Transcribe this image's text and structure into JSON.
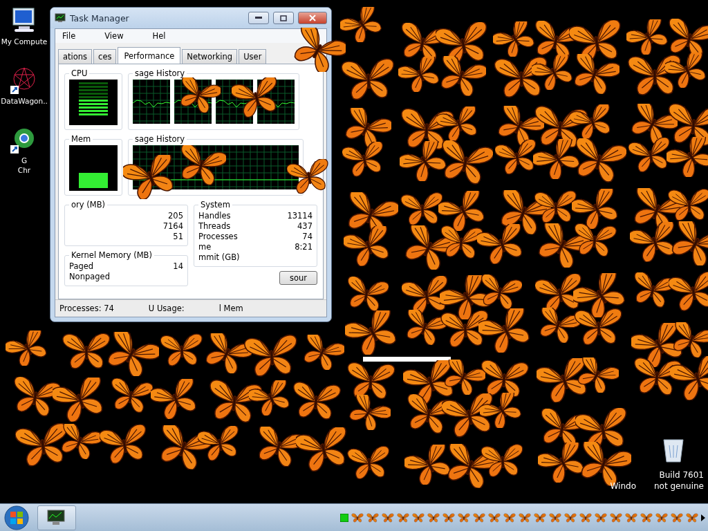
{
  "desktop_icons": [
    {
      "kind": "computer",
      "lines": [
        "My Compute"
      ]
    },
    {
      "kind": "shortcut",
      "lines": [
        "DataWagon.."
      ]
    },
    {
      "kind": "browser",
      "lines": [
        "G",
        "Chr"
      ]
    }
  ],
  "window": {
    "title": "Task Manager",
    "menu": [
      "File",
      "View",
      "Hel"
    ],
    "tabs": [
      {
        "label": "ations",
        "selected": false
      },
      {
        "label": "ces",
        "selected": false
      },
      {
        "label": "Performance",
        "selected": true
      },
      {
        "label": "Networking",
        "selected": false
      },
      {
        "label": "User",
        "selected": false
      }
    ],
    "cpu_title": "CPU",
    "cpu_history_title": "sage History",
    "memory_title": "Mem",
    "memory_history_title": "sage History",
    "physical_memory": {
      "title": "ory (MB)",
      "values": [
        "205",
        "7164",
        "51"
      ]
    },
    "kernel_memory": {
      "title": "Kernel Memory (MB)",
      "rows": [
        {
          "label": "Paged",
          "value": "14"
        },
        {
          "label": "Nonpaged"
        }
      ]
    },
    "system": {
      "title": "System",
      "rows": [
        {
          "label": "Handles",
          "value": "13114"
        },
        {
          "label": "Threads",
          "value": "437"
        },
        {
          "label": "Processes",
          "value": "74"
        },
        {
          "label": "me",
          "value": "8:21"
        },
        {
          "label": "mmit (GB)"
        }
      ]
    },
    "resource_button": "sour",
    "status_bar": [
      "Processes: 74",
      "U Usage:",
      "l Mem"
    ]
  },
  "genuine_notice": {
    "build": "Build 7601",
    "parts": [
      "Windo",
      "not genuine"
    ]
  }
}
